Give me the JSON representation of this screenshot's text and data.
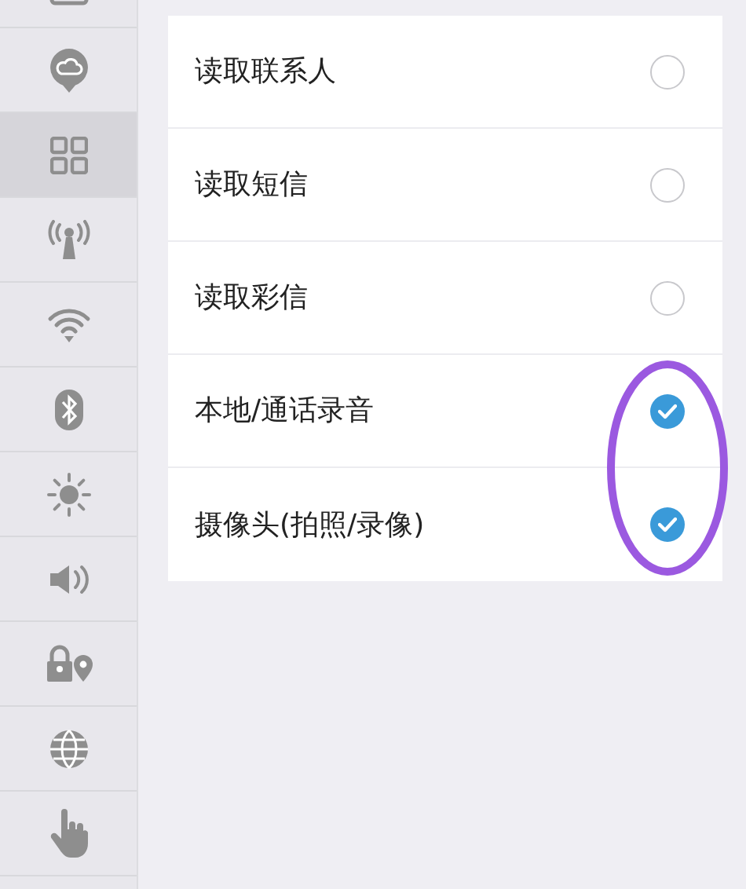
{
  "sidebar": {
    "items": [
      {
        "kind": "square",
        "selected": false
      },
      {
        "kind": "cloud",
        "selected": false
      },
      {
        "kind": "grid",
        "selected": true
      },
      {
        "kind": "antenna",
        "selected": false
      },
      {
        "kind": "wifi",
        "selected": false
      },
      {
        "kind": "bluetooth",
        "selected": false
      },
      {
        "kind": "sun",
        "selected": false
      },
      {
        "kind": "volume",
        "selected": false
      },
      {
        "kind": "lock-pin",
        "selected": false
      },
      {
        "kind": "globe",
        "selected": false
      },
      {
        "kind": "hand",
        "selected": false
      }
    ]
  },
  "permissions": [
    {
      "label": "读取联系人",
      "checked": false
    },
    {
      "label": "读取短信",
      "checked": false
    },
    {
      "label": "读取彩信",
      "checked": false
    },
    {
      "label": "本地/通话录音",
      "checked": true
    },
    {
      "label": "摄像头(拍照/录像)",
      "checked": true
    }
  ],
  "annotation": {
    "kind": "ellipse",
    "color": "#9b59e0"
  }
}
